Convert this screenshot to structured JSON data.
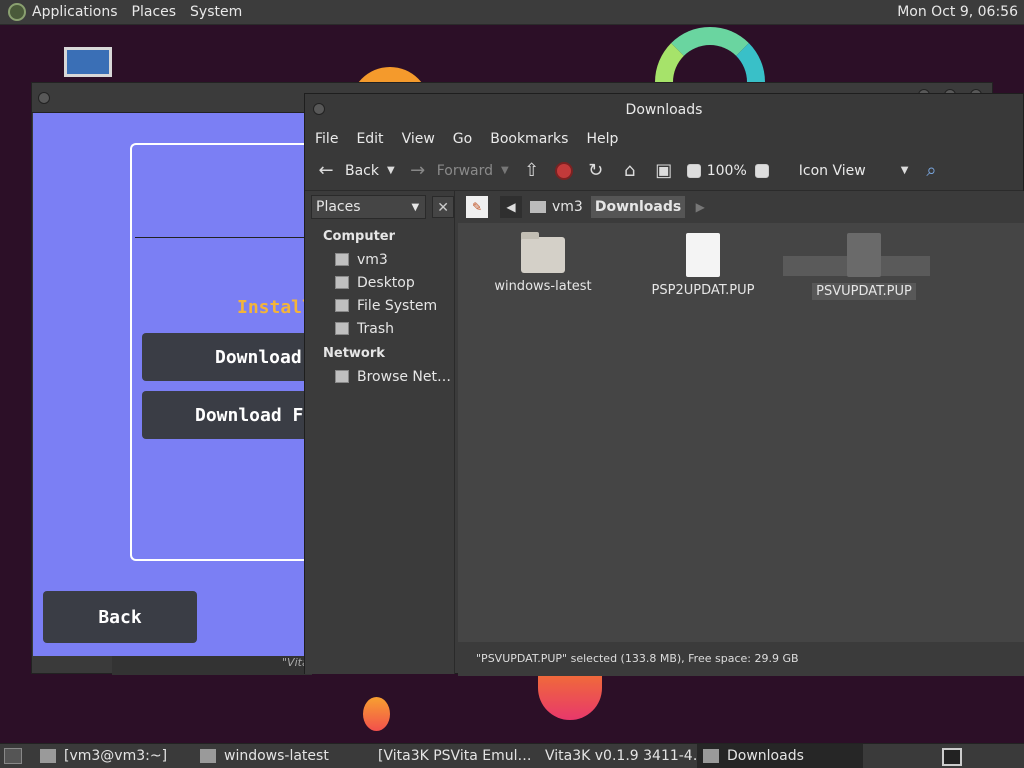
{
  "top_panel": {
    "menus": [
      "Applications",
      "Places",
      "System"
    ],
    "clock": "Mon Oct  9, 06:56"
  },
  "vita_window": {
    "install_text": "Install",
    "btn_download": "Download",
    "btn_download_fw": "Download Fo",
    "btn_back": "Back",
    "status_text": "\"Vita"
  },
  "file_manager": {
    "title": "Downloads",
    "menus": [
      "File",
      "Edit",
      "View",
      "Go",
      "Bookmarks",
      "Help"
    ],
    "toolbar": {
      "back": "Back",
      "forward": "Forward",
      "zoom": "100%",
      "view_mode": "Icon View"
    },
    "sidebar": {
      "places_label": "Places",
      "sections": [
        {
          "title": "Computer",
          "items": [
            "vm3",
            "Desktop",
            "File System",
            "Trash"
          ]
        },
        {
          "title": "Network",
          "items": [
            "Browse Net…"
          ]
        }
      ]
    },
    "path": [
      "vm3",
      "Downloads"
    ],
    "files": [
      {
        "name": "windows-latest",
        "type": "folder-icon"
      },
      {
        "name": "PSP2UPDAT.PUP",
        "type": "file-icon"
      },
      {
        "name": "PSVUPDAT.PUP",
        "type": "file-icon",
        "selected": true
      }
    ],
    "status": "\"PSVUPDAT.PUP\" selected (133.8 MB), Free space: 29.9 GB"
  },
  "taskbar": {
    "tasks": [
      {
        "label": "[vm3@vm3:~]",
        "active": false
      },
      {
        "label": "windows-latest",
        "active": false
      },
      {
        "label": "[Vita3K PSVita Emul…",
        "active": false
      },
      {
        "label": "Vita3K v0.1.9 3411-4…",
        "active": false
      },
      {
        "label": "Downloads",
        "active": true
      }
    ]
  }
}
